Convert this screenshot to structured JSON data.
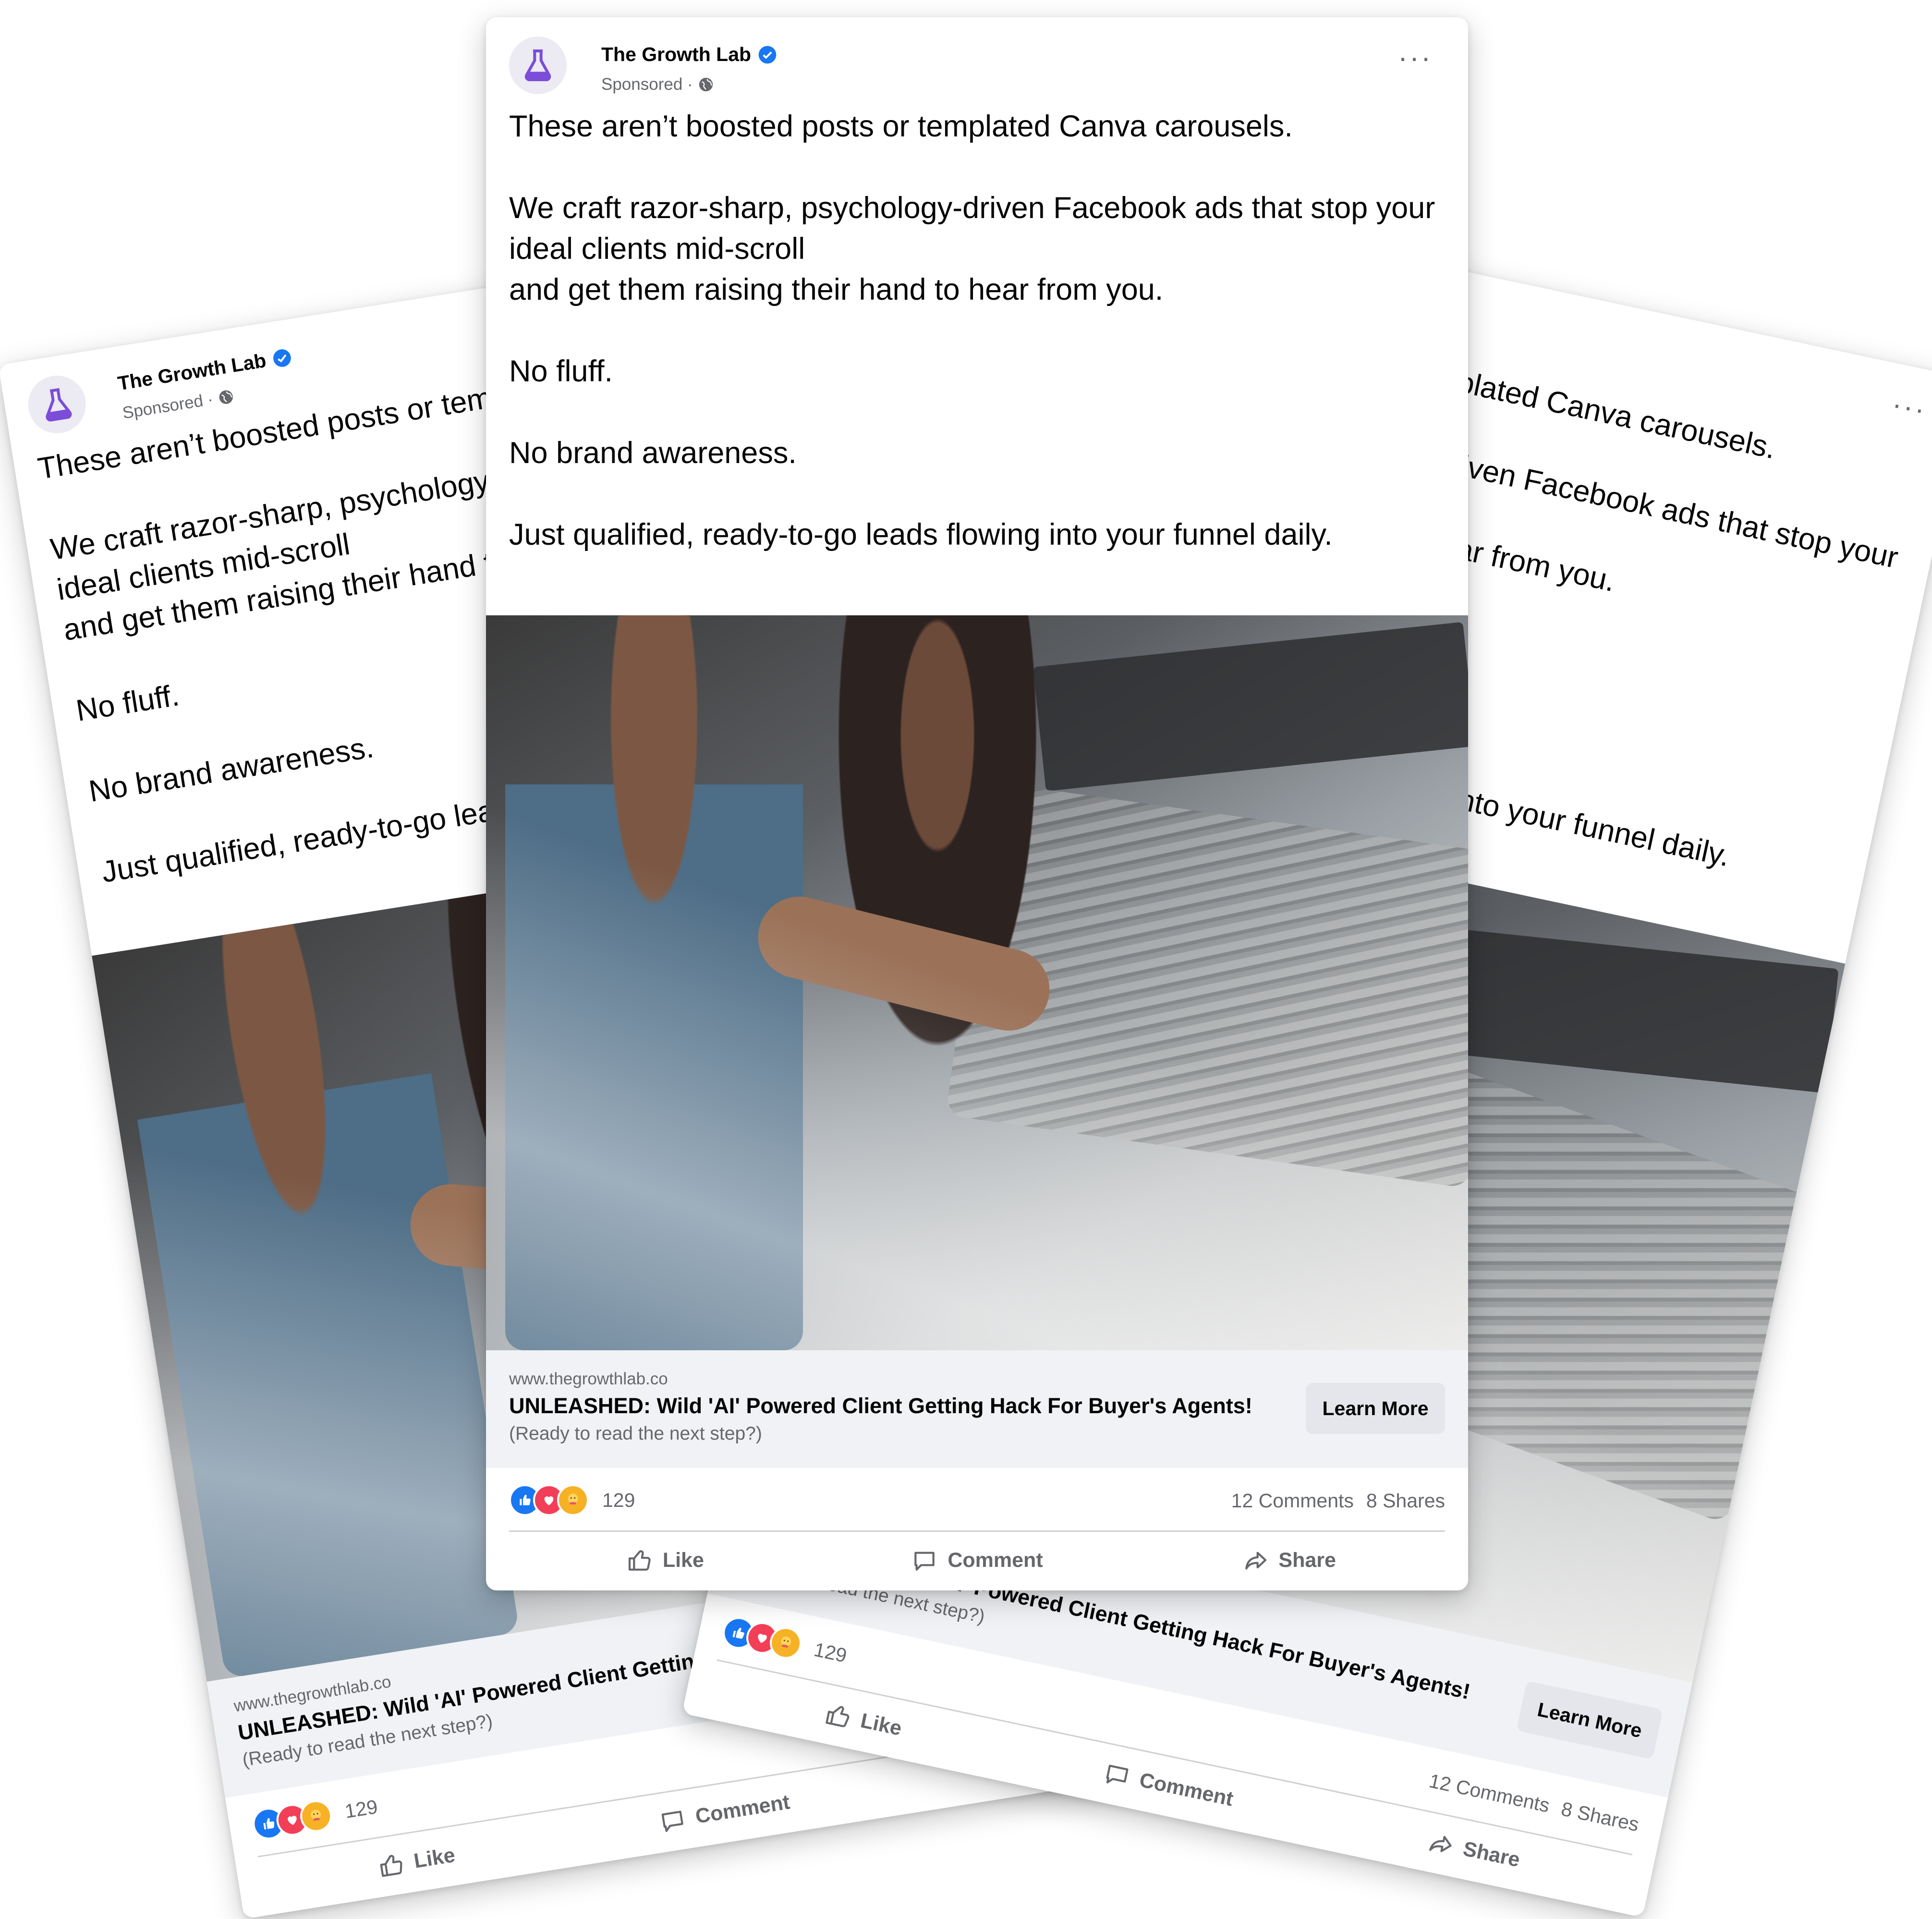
{
  "post": {
    "page_name": "The Growth Lab",
    "sponsored": "Sponsored ·",
    "more_icon": "more-horizontal-icon",
    "paragraphs": [
      "These aren’t boosted posts or templated Canva carousels.",
      "We craft razor-sharp, psychology-driven Facebook ads that stop your ideal clients mid-scroll",
      "and get them raising their hand to hear from you.",
      "No fluff.",
      "No brand awareness.",
      "Just qualified, ready-to-go leads flowing into your funnel daily."
    ],
    "link": {
      "domain": "www.thegrowthlab.co",
      "headline": "UNLEASHED: Wild 'AI' Powered Client Getting Hack For Buyer's Agents!",
      "subtext": "(Ready to read the next step?)",
      "cta": "Learn More"
    },
    "stats": {
      "reaction_count": "129",
      "comments": "12 Comments",
      "shares": "8 Shares"
    },
    "actions": {
      "like": "Like",
      "comment": "Comment",
      "share": "Share"
    }
  },
  "colors": {
    "brand_purple": "#7b4dd8",
    "verified_blue": "#1877f2",
    "link_bar_bg": "#f0f2f5",
    "secondary_text": "#65676b"
  }
}
